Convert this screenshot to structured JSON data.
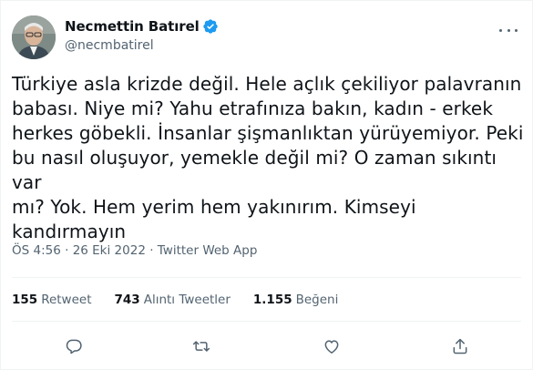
{
  "author": {
    "display_name": "Necmettin Batırel",
    "handle": "@necmbatirel",
    "verified": true,
    "avatar_icon": "avatar-portrait"
  },
  "tweet": {
    "text": "Türkiye asla krizde değil. Hele açlık çekiliyor palavranın\nbabası. Niye mi? Yahu etrafınıza bakın, kadın - erkek\nherkes göbekli. İnsanlar şişmanlıktan yürüyemiyor. Peki\nbu nasıl oluşuyor, yemekle değil mi? O zaman sıkıntı var\nmı? Yok. Hem yerim hem yakınırım. Kimseyi\nkandırmayın"
  },
  "meta": {
    "time": "ÖS 4:56",
    "separator1": " · ",
    "date": "26 Eki 2022",
    "separator2": " · ",
    "source": "Twitter Web App"
  },
  "stats": {
    "retweets_count": "155",
    "retweets_label": "Retweet",
    "quotes_count": "743",
    "quotes_label": "Alıntı Tweetler",
    "likes_count": "1.155",
    "likes_label": "Beğeni"
  },
  "actions": [
    {
      "icon": "reply-icon"
    },
    {
      "icon": "retweet-icon"
    },
    {
      "icon": "like-icon"
    },
    {
      "icon": "share-icon"
    }
  ],
  "colors": {
    "text": "#0f1419",
    "secondary": "#536471",
    "verified": "#1d9bf0",
    "divider": "#eff3f4"
  }
}
